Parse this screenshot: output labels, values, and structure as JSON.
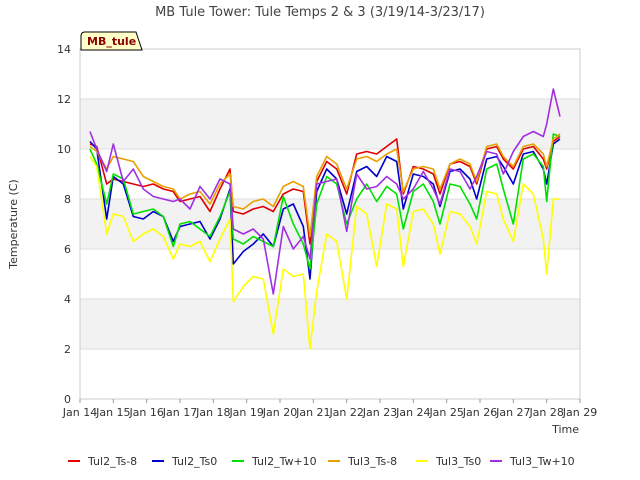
{
  "chart_data": {
    "type": "line",
    "title": "MB Tule Tower: Tule Temps 2 & 3 (3/19/14-3/23/17)",
    "xlabel": "Time",
    "ylabel": "Temperature (C)",
    "badge": "MB_tule",
    "ylim": [
      0,
      14
    ],
    "yticks": [
      0,
      2,
      4,
      6,
      8,
      10,
      12,
      14
    ],
    "xlim": [
      14,
      29
    ],
    "xticks": [
      14,
      15,
      16,
      17,
      18,
      19,
      20,
      21,
      22,
      23,
      24,
      25,
      26,
      27,
      28,
      29
    ],
    "xtick_labels": [
      "Jan 14",
      "Jan 15",
      "Jan 16",
      "Jan 17",
      "Jan 18",
      "Jan 19",
      "Jan 20",
      "Jan 21",
      "Jan 22",
      "Jan 23",
      "Jan 24",
      "Jan 25",
      "Jan 26",
      "Jan 27",
      "Jan 28",
      "Jan 29"
    ],
    "grid": "horizontal bands",
    "legend_position": "bottom",
    "series": [
      {
        "name": "Tul2_Ts-8",
        "color": "#e00000",
        "x": [
          14.3,
          14.5,
          14.8,
          15.0,
          15.3,
          15.6,
          15.9,
          16.2,
          16.5,
          16.8,
          17.0,
          17.3,
          17.6,
          17.9,
          18.2,
          18.5,
          18.6,
          18.9,
          19.2,
          19.5,
          19.8,
          20.1,
          20.4,
          20.7,
          20.9,
          21.1,
          21.4,
          21.7,
          22.0,
          22.3,
          22.6,
          22.9,
          23.2,
          23.5,
          23.7,
          24.0,
          24.3,
          24.6,
          24.8,
          25.1,
          25.4,
          25.7,
          25.9,
          26.2,
          26.5,
          26.7,
          27.0,
          27.3,
          27.6,
          27.9,
          28.0,
          28.2,
          28.4
        ],
        "values": [
          10.2,
          10.1,
          8.6,
          8.8,
          8.7,
          8.6,
          8.5,
          8.6,
          8.4,
          8.3,
          7.9,
          8.0,
          8.1,
          7.5,
          8.4,
          9.2,
          7.5,
          7.4,
          7.6,
          7.7,
          7.5,
          8.2,
          8.4,
          8.3,
          6.2,
          8.7,
          9.5,
          9.2,
          8.2,
          9.8,
          9.9,
          9.8,
          10.1,
          10.4,
          8.2,
          9.3,
          9.2,
          9.0,
          8.2,
          9.4,
          9.5,
          9.3,
          8.6,
          10.0,
          10.1,
          9.6,
          9.2,
          10.0,
          10.1,
          9.6,
          9.2,
          10.3,
          10.5
        ]
      },
      {
        "name": "Tul2_Ts0",
        "color": "#0000cc",
        "x": [
          14.3,
          14.5,
          14.8,
          15.0,
          15.3,
          15.6,
          15.9,
          16.2,
          16.5,
          16.8,
          17.0,
          17.3,
          17.6,
          17.9,
          18.2,
          18.5,
          18.6,
          18.9,
          19.2,
          19.5,
          19.8,
          20.1,
          20.4,
          20.7,
          20.9,
          21.1,
          21.4,
          21.7,
          22.0,
          22.3,
          22.6,
          22.9,
          23.2,
          23.5,
          23.7,
          24.0,
          24.3,
          24.6,
          24.8,
          25.1,
          25.4,
          25.7,
          25.9,
          26.2,
          26.5,
          26.7,
          27.0,
          27.3,
          27.6,
          27.9,
          28.0,
          28.2,
          28.4
        ],
        "values": [
          10.3,
          10.0,
          7.2,
          8.9,
          8.6,
          7.3,
          7.2,
          7.5,
          7.3,
          6.3,
          6.9,
          7.0,
          7.1,
          6.4,
          7.2,
          8.4,
          5.4,
          5.9,
          6.2,
          6.6,
          6.1,
          7.6,
          7.8,
          6.9,
          4.8,
          8.3,
          9.2,
          8.8,
          7.4,
          9.1,
          9.3,
          8.9,
          9.7,
          9.5,
          7.6,
          9.0,
          8.9,
          8.6,
          7.7,
          9.1,
          9.2,
          8.8,
          8.0,
          9.6,
          9.7,
          9.3,
          8.6,
          9.8,
          9.9,
          9.2,
          8.6,
          10.2,
          10.4
        ]
      },
      {
        "name": "Tul2_Tw+10",
        "color": "#00e000",
        "x": [
          14.3,
          14.5,
          14.8,
          15.0,
          15.3,
          15.6,
          15.9,
          16.2,
          16.5,
          16.8,
          17.0,
          17.3,
          17.6,
          17.9,
          18.2,
          18.5,
          18.6,
          18.9,
          19.2,
          19.5,
          19.8,
          20.1,
          20.4,
          20.7,
          20.9,
          21.1,
          21.4,
          21.7,
          22.0,
          22.3,
          22.6,
          22.9,
          23.2,
          23.5,
          23.7,
          24.0,
          24.3,
          24.6,
          24.8,
          25.1,
          25.4,
          25.7,
          25.9,
          26.2,
          26.5,
          26.7,
          27.0,
          27.3,
          27.6,
          27.9,
          28.0,
          28.2,
          28.4
        ],
        "values": [
          10.0,
          9.4,
          7.8,
          9.0,
          8.8,
          7.4,
          7.5,
          7.6,
          7.3,
          6.1,
          7.0,
          7.1,
          6.8,
          6.5,
          7.3,
          8.3,
          6.4,
          6.2,
          6.5,
          6.3,
          6.1,
          8.1,
          7.0,
          6.2,
          5.2,
          7.8,
          8.9,
          8.6,
          7.0,
          8.0,
          8.6,
          7.9,
          8.5,
          8.2,
          6.8,
          8.3,
          8.6,
          7.9,
          7.0,
          8.6,
          8.5,
          7.8,
          7.2,
          9.2,
          9.4,
          8.4,
          7.0,
          9.6,
          9.8,
          9.3,
          7.9,
          10.6,
          10.5
        ]
      },
      {
        "name": "Tul3_Ts-8",
        "color": "#e8a000",
        "x": [
          14.3,
          14.5,
          14.8,
          15.0,
          15.3,
          15.6,
          15.9,
          16.2,
          16.5,
          16.8,
          17.0,
          17.3,
          17.6,
          17.9,
          18.2,
          18.5,
          18.6,
          18.9,
          19.2,
          19.5,
          19.8,
          20.1,
          20.4,
          20.7,
          20.9,
          21.1,
          21.4,
          21.7,
          22.0,
          22.3,
          22.6,
          22.9,
          23.2,
          23.5,
          23.7,
          24.0,
          24.3,
          24.6,
          24.8,
          25.1,
          25.4,
          25.7,
          25.9,
          26.2,
          26.5,
          26.7,
          27.0,
          27.3,
          27.6,
          27.9,
          28.0,
          28.2,
          28.4
        ],
        "values": [
          10.1,
          9.9,
          9.2,
          9.7,
          9.6,
          9.5,
          8.9,
          8.7,
          8.5,
          8.4,
          8.0,
          8.2,
          8.3,
          7.8,
          8.6,
          9.0,
          7.7,
          7.6,
          7.9,
          8.0,
          7.7,
          8.5,
          8.7,
          8.5,
          6.5,
          8.9,
          9.7,
          9.4,
          8.4,
          9.6,
          9.7,
          9.5,
          9.8,
          10.0,
          8.3,
          9.2,
          9.3,
          9.2,
          8.4,
          9.4,
          9.6,
          9.4,
          8.7,
          10.1,
          10.2,
          9.7,
          9.3,
          10.1,
          10.2,
          9.8,
          9.3,
          10.4,
          10.6
        ]
      },
      {
        "name": "Tul3_Ts0",
        "color": "#ffff00",
        "x": [
          14.3,
          14.5,
          14.8,
          15.0,
          15.3,
          15.6,
          15.9,
          16.2,
          16.5,
          16.8,
          17.0,
          17.3,
          17.6,
          17.9,
          18.2,
          18.5,
          18.6,
          18.9,
          19.2,
          19.5,
          19.8,
          20.1,
          20.4,
          20.7,
          20.9,
          21.1,
          21.4,
          21.7,
          22.0,
          22.3,
          22.6,
          22.9,
          23.2,
          23.5,
          23.7,
          24.0,
          24.3,
          24.6,
          24.8,
          25.1,
          25.4,
          25.7,
          25.9,
          26.2,
          26.5,
          26.7,
          27.0,
          27.3,
          27.6,
          27.9,
          28.0,
          28.2,
          28.4
        ],
        "values": [
          9.7,
          9.3,
          6.6,
          7.4,
          7.3,
          6.3,
          6.6,
          6.8,
          6.5,
          5.6,
          6.2,
          6.1,
          6.3,
          5.5,
          6.4,
          7.2,
          3.9,
          4.5,
          4.9,
          4.8,
          2.6,
          5.2,
          4.9,
          5.0,
          2.0,
          4.3,
          6.6,
          6.3,
          4.0,
          7.7,
          7.4,
          5.3,
          7.8,
          7.6,
          5.3,
          7.5,
          7.6,
          7.0,
          5.8,
          7.5,
          7.4,
          6.9,
          6.2,
          8.3,
          8.2,
          7.2,
          6.3,
          8.6,
          8.2,
          6.4,
          5.0,
          8.0,
          8.0
        ]
      },
      {
        "name": "Tul3_Tw+10",
        "color": "#a030e0",
        "x": [
          14.3,
          14.5,
          14.8,
          15.0,
          15.3,
          15.6,
          15.9,
          16.2,
          16.5,
          16.8,
          17.0,
          17.3,
          17.6,
          17.9,
          18.2,
          18.5,
          18.6,
          18.9,
          19.2,
          19.5,
          19.8,
          20.1,
          20.4,
          20.7,
          20.9,
          21.1,
          21.4,
          21.7,
          22.0,
          22.3,
          22.6,
          22.9,
          23.2,
          23.5,
          23.7,
          24.0,
          24.3,
          24.6,
          24.8,
          25.1,
          25.4,
          25.7,
          25.9,
          26.2,
          26.5,
          26.7,
          27.0,
          27.3,
          27.6,
          27.9,
          28.0,
          28.2,
          28.4
        ],
        "values": [
          10.7,
          10.0,
          9.1,
          10.2,
          8.7,
          9.2,
          8.4,
          8.1,
          8.0,
          7.9,
          8.0,
          7.6,
          8.5,
          8.0,
          8.8,
          8.6,
          6.8,
          6.6,
          6.8,
          6.4,
          4.2,
          6.9,
          6.0,
          6.5,
          5.6,
          8.6,
          8.7,
          8.8,
          6.7,
          9.0,
          8.4,
          8.5,
          8.9,
          8.6,
          8.0,
          8.4,
          9.1,
          8.4,
          7.8,
          9.2,
          9.1,
          8.4,
          8.9,
          9.9,
          9.8,
          9.0,
          9.9,
          10.5,
          10.7,
          10.5,
          11.0,
          12.4,
          11.3
        ]
      }
    ]
  }
}
